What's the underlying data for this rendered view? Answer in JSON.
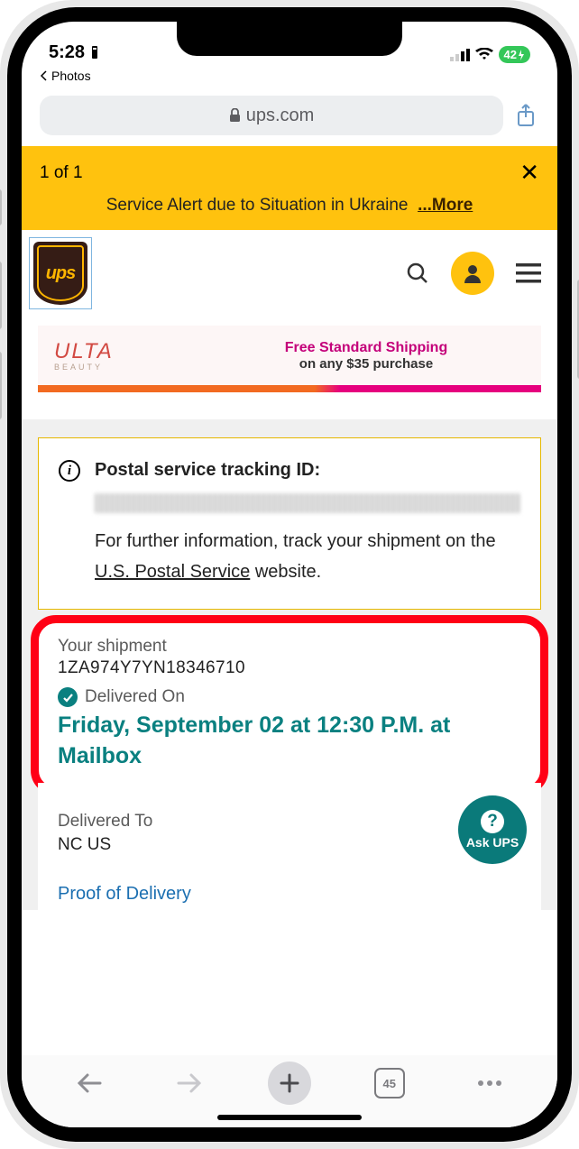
{
  "status": {
    "time": "5:28",
    "battery": "42",
    "back_app": "Photos"
  },
  "browser": {
    "domain": "ups.com",
    "tab_count": "45"
  },
  "alert": {
    "counter": "1 of 1",
    "message": "Service Alert due to Situation in Ukraine",
    "more": "...More"
  },
  "header": {
    "logo_text": "ups"
  },
  "promo": {
    "brand": "ULTA",
    "brand_sub": "BEAUTY",
    "line1": "Free Standard Shipping",
    "line2": "on any $35 purchase"
  },
  "info": {
    "title": "Postal service tracking ID:",
    "text_pre": "For further information, track your shipment on the ",
    "link": "U.S. Postal Service",
    "text_post": " website."
  },
  "shipment": {
    "label": "Your shipment",
    "tracking": "1ZA974Y7YN18346710",
    "status": "Delivered On",
    "when": "Friday, September 02 at 12:30 P.M. at Mailbox"
  },
  "delivered_to": {
    "label": "Delivered To",
    "value": "NC US"
  },
  "ask_ups": "Ask UPS",
  "proof": "Proof of Delivery"
}
